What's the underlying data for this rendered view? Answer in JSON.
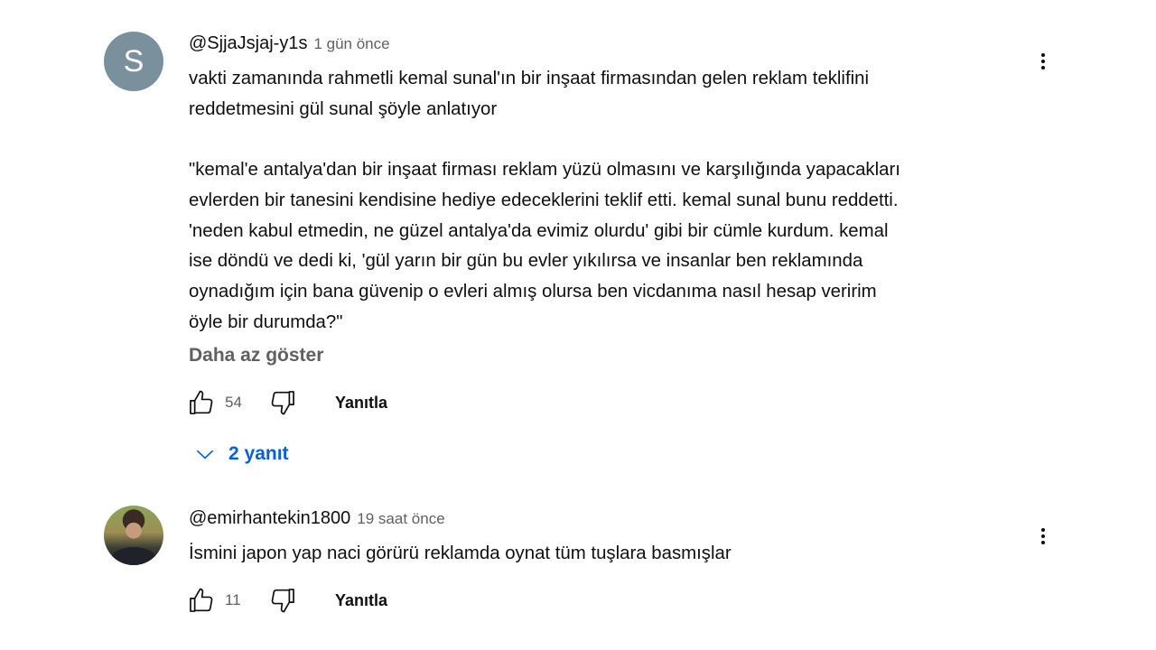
{
  "comments": [
    {
      "avatar_letter": "S",
      "avatar_color": "#7b909d",
      "author": "@SjjaJsjaj-y1s",
      "time": "1 gün önce",
      "text": "vakti zamanında rahmetli kemal sunal'ın bir inşaat firmasından gelen reklam teklifini\nreddetmesini gül sunal şöyle anlatıyor\n\n\"kemal'e antalya'dan bir inşaat firması reklam yüzü olmasını ve karşılığında yapacakları\nevlerden bir tanesini kendisine hediye edeceklerini teklif etti. kemal sunal bunu reddetti.\n'neden kabul etmedin, ne güzel antalya'da evimiz olurdu' gibi bir cümle kurdum. kemal\nise döndü ve dedi ki, 'gül yarın bir gün bu evler yıkılırsa ve insanlar ben reklamında\noynadığım için bana güvenip o evleri almış olursa ben vicdanıma nasıl hesap veririm\nöyle bir durumda?\"",
      "show_less": "Daha az göster",
      "likes": "54",
      "reply_label": "Yanıtla",
      "replies_label": "2 yanıt"
    },
    {
      "author": "@emirhantekin1800",
      "time": "19 saat önce",
      "text": "İsmini japon yap naci görürü reklamda oynat tüm tuşlara basmışlar",
      "likes": "11",
      "reply_label": "Yanıtla"
    }
  ],
  "icons": {
    "like": "thumb-up-icon",
    "dislike": "thumb-down-icon",
    "menu": "more-vert-icon",
    "expand": "chevron-down-icon"
  },
  "colors": {
    "link_blue": "#065fd4",
    "secondary_text": "#606060"
  }
}
